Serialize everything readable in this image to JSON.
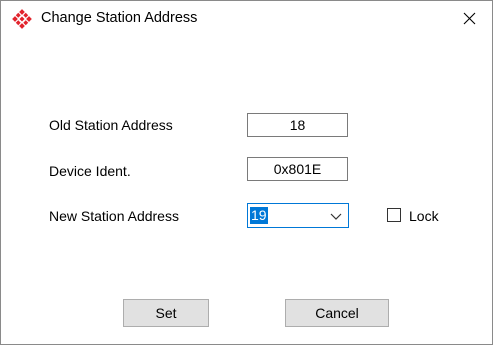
{
  "window": {
    "title": "Change Station Address"
  },
  "icons": {
    "app": "pattern-logo-icon",
    "close": "close-icon",
    "dropdown": "chevron-down-icon"
  },
  "colors": {
    "accent": "#0078d7",
    "logo_red": "#e2232c",
    "button_bg": "#e1e1e1"
  },
  "form": {
    "old_address": {
      "label": "Old Station Address",
      "value": "18"
    },
    "device_ident": {
      "label": "Device Ident.",
      "value": "0x801E"
    },
    "new_address": {
      "label": "New Station Address",
      "value": "19"
    },
    "lock": {
      "label": "Lock",
      "checked": false
    }
  },
  "buttons": {
    "set": "Set",
    "cancel": "Cancel"
  }
}
